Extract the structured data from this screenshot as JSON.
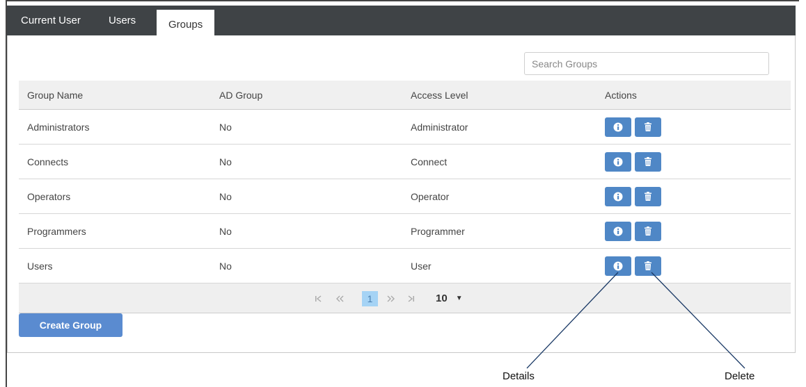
{
  "tabs": [
    {
      "label": "Current User",
      "active": false
    },
    {
      "label": "Users",
      "active": false
    },
    {
      "label": "Groups",
      "active": true
    }
  ],
  "search": {
    "placeholder": "Search Groups",
    "value": ""
  },
  "table": {
    "headers": [
      "Group Name",
      "AD Group",
      "Access Level",
      "Actions"
    ],
    "rows": [
      {
        "name": "Administrators",
        "ad_group": "No",
        "access_level": "Administrator"
      },
      {
        "name": "Connects",
        "ad_group": "No",
        "access_level": "Connect"
      },
      {
        "name": "Operators",
        "ad_group": "No",
        "access_level": "Operator"
      },
      {
        "name": "Programmers",
        "ad_group": "No",
        "access_level": "Programmer"
      },
      {
        "name": "Users",
        "ad_group": "No",
        "access_level": "User"
      }
    ],
    "action_icons": [
      "info-icon",
      "trash-icon"
    ]
  },
  "pager": {
    "current_page": "1",
    "page_size": "10"
  },
  "create_button": "Create Group",
  "callouts": {
    "details": "Details",
    "delete": "Delete"
  },
  "colors": {
    "tabbar": "#3f4346",
    "button": "#4f87c6",
    "create_button": "#5a8bd0",
    "active_page": "#a5d3f5"
  }
}
